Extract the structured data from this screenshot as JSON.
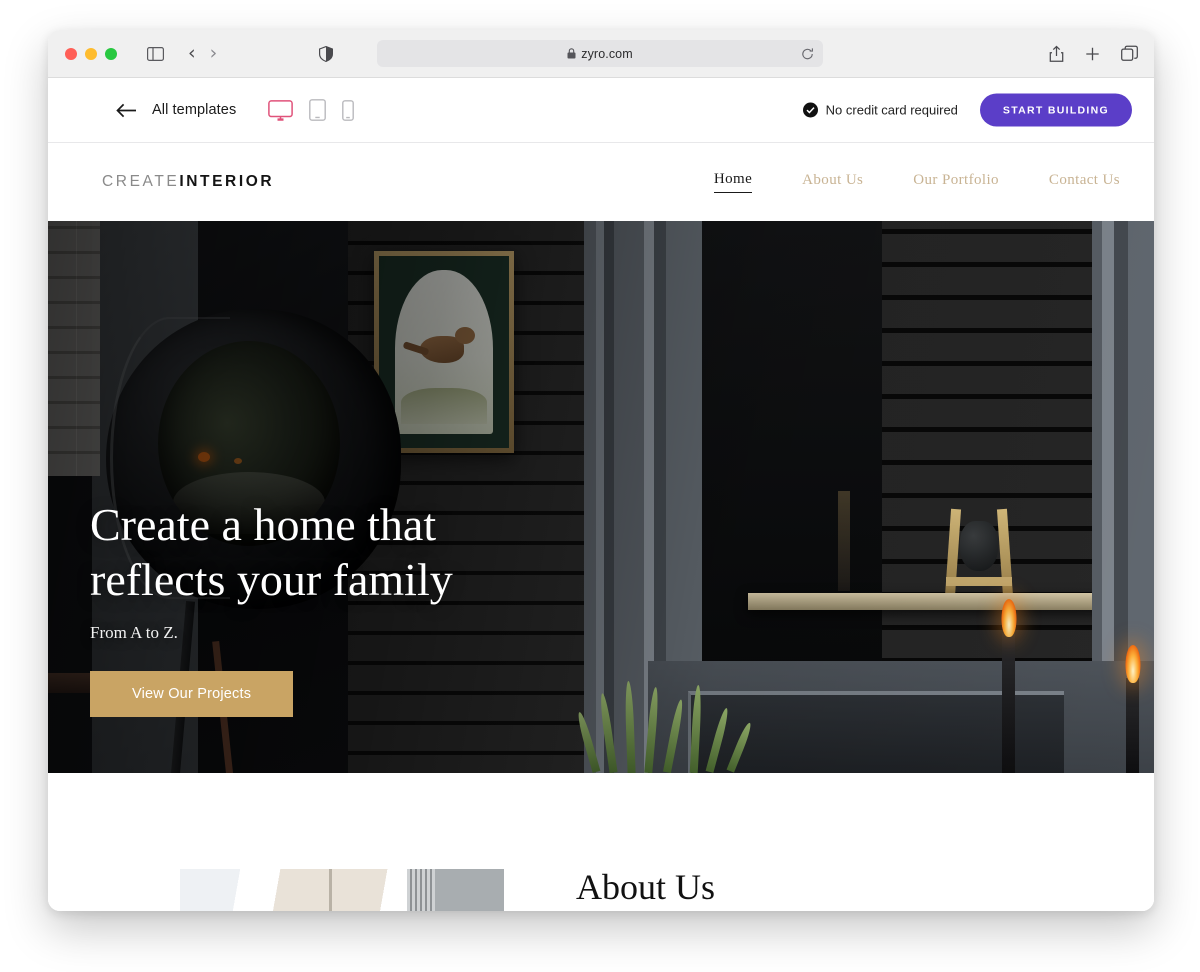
{
  "browser": {
    "traffic_lights": [
      "close",
      "minimize",
      "maximize"
    ],
    "sidebar_icon": "sidebar-toggle-icon",
    "back_icon": "chevron-left-icon",
    "forward_icon": "chevron-right-icon",
    "shield_icon": "privacy-shield-icon",
    "url": "zyro.com",
    "lock_icon": "lock-icon",
    "reload_icon": "reload-icon",
    "share_icon": "share-icon",
    "new_tab_icon": "plus-icon",
    "tabs_icon": "tab-overview-icon"
  },
  "template_bar": {
    "back_icon": "arrow-left-icon",
    "back_label": "All templates",
    "devices": [
      {
        "name": "desktop",
        "icon": "desktop-icon",
        "active": true
      },
      {
        "name": "tablet",
        "icon": "tablet-icon",
        "active": false
      },
      {
        "name": "mobile",
        "icon": "mobile-icon",
        "active": false
      }
    ],
    "notice": "No credit card required",
    "notice_icon": "check-circle-icon",
    "cta_label": "START BUILDING",
    "cta_color": "#5b3ec8",
    "active_device_color": "#e0527a"
  },
  "site": {
    "logo": {
      "first": "CREATE",
      "second": "INTERIOR"
    },
    "menu": [
      {
        "label": "Home",
        "active": true
      },
      {
        "label": "About Us",
        "active": false
      },
      {
        "label": "Our Portfolio",
        "active": false
      },
      {
        "label": "Contact Us",
        "active": false
      }
    ],
    "menu_color": "#c8b393",
    "menu_active_color": "#1a1a1a",
    "hero": {
      "title_line1": "Create a home that",
      "title_line2": "reflects your family",
      "subtitle": "From A to Z.",
      "button_label": "View Our Projects",
      "button_color": "#c9a464",
      "image_alt": "dark interior with vintage lamp, framed bird print, shelf and lit candles"
    },
    "about": {
      "title": "About Us",
      "image_alt": "bright minimal interior room"
    }
  }
}
